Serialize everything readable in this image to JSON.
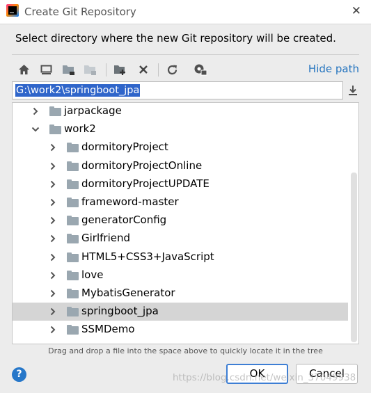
{
  "window": {
    "title": "Create Git Repository",
    "close_glyph": "✕"
  },
  "instruction": "Select directory where the new Git repository will be created.",
  "toolbar": {
    "icons": [
      "home-icon",
      "desktop-icon",
      "project-folder-icon",
      "module-folder-icon",
      "new-folder-icon",
      "delete-icon",
      "refresh-icon",
      "show-hidden-icon"
    ],
    "hide_path_label": "Hide path"
  },
  "path": {
    "value": "G:\\work2\\springboot_jpa"
  },
  "tree": {
    "rows": [
      {
        "label": "jarpackage",
        "expanded": false,
        "depth": 1
      },
      {
        "label": "work2",
        "expanded": true,
        "depth": 1
      },
      {
        "label": "dormitoryProject",
        "expanded": false,
        "depth": 2
      },
      {
        "label": "dormitoryProjectOnline",
        "expanded": false,
        "depth": 2
      },
      {
        "label": "dormitoryProjectUPDATE",
        "expanded": false,
        "depth": 2
      },
      {
        "label": "frameword-master",
        "expanded": false,
        "depth": 2
      },
      {
        "label": "generatorConfig",
        "expanded": false,
        "depth": 2
      },
      {
        "label": "Girlfriend",
        "expanded": false,
        "depth": 2
      },
      {
        "label": "HTML5+CSS3+JavaScript",
        "expanded": false,
        "depth": 2
      },
      {
        "label": "love",
        "expanded": false,
        "depth": 2
      },
      {
        "label": "MybatisGenerator",
        "expanded": false,
        "depth": 2
      },
      {
        "label": "springboot_jpa",
        "expanded": false,
        "depth": 2,
        "selected": true
      },
      {
        "label": "SSMDemo",
        "expanded": false,
        "depth": 2
      }
    ]
  },
  "hint": "Drag and drop a file into the space above to quickly locate it in the tree",
  "buttons": {
    "help": "?",
    "ok": "OK",
    "cancel": "Cancel"
  },
  "watermark": "https://blog.csdn.net/weixin_37049938",
  "colors": {
    "selection": "#2f65ca",
    "link": "#2675bf",
    "folder": "#9aa7b0",
    "selected_row": "#d5d5d5"
  }
}
